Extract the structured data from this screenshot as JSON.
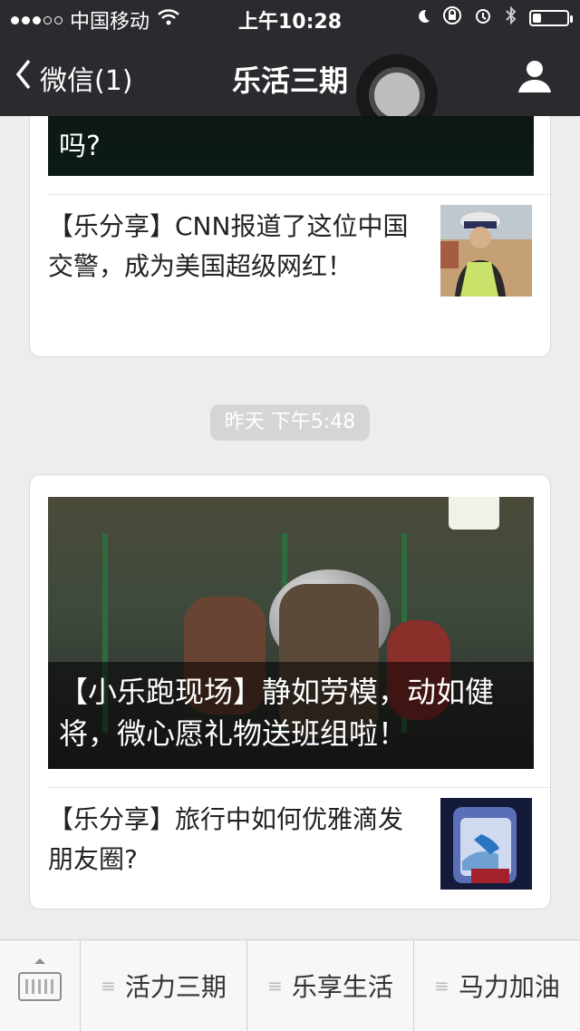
{
  "status_bar": {
    "carrier": "中国移动",
    "time": "上午10:28",
    "battery_level": 0.25
  },
  "nav": {
    "back_label": "微信(1)",
    "title": "乐活三期"
  },
  "card1": {
    "cover_caption": "吗?",
    "item_title": "【乐分享】CNN报道了这位中国交警，成为美国超级网红！"
  },
  "time_divider": "昨天 下午5:48",
  "card2": {
    "cover_caption": "【小乐跑现场】静如劳模，动如健将，微心愿礼物送班组啦！",
    "item_title": "【乐分享】旅行中如何优雅滴发朋友圈?"
  },
  "bottom_menu": {
    "items": [
      "活力三期",
      "乐享生活",
      "马力加油"
    ]
  },
  "icons": {
    "wifi": "wifi-icon",
    "moon": "moon-icon",
    "orientation_lock": "orientation-lock-icon",
    "alarm": "alarm-icon",
    "bluetooth": "bluetooth-icon",
    "user": "user-icon",
    "keyboard": "keyboard-icon",
    "menu": "menu-icon"
  }
}
